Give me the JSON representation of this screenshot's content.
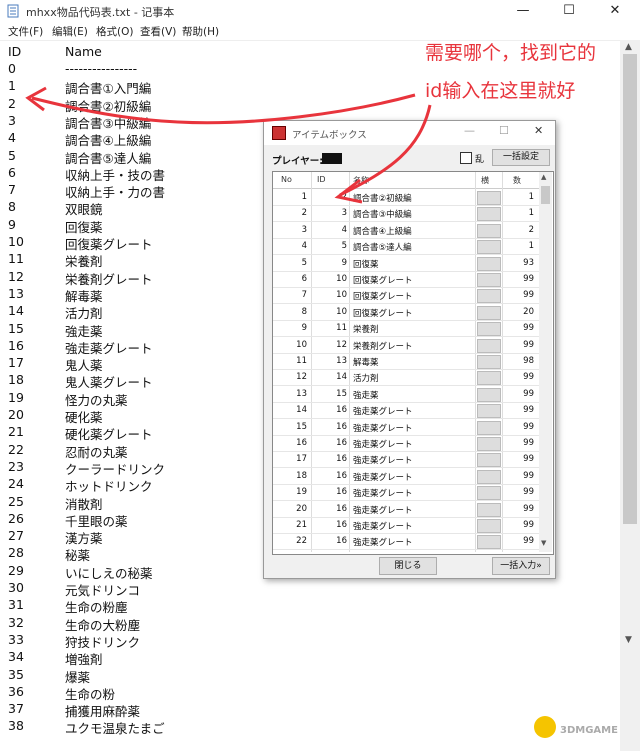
{
  "notepad": {
    "title": "mhxx物品代码表.txt - 记事本",
    "window_buttons": [
      "—",
      "☐",
      "✕"
    ],
    "menu": [
      "文件(F)",
      "编辑(E)",
      "格式(O)",
      "查看(V)",
      "帮助(H)"
    ],
    "header": {
      "id": "ID",
      "name": "Name"
    },
    "rows": [
      {
        "id": "0",
        "name": "----------------"
      },
      {
        "id": "1",
        "name": "調合書①入門編"
      },
      {
        "id": "2",
        "name": "調合書②初級編"
      },
      {
        "id": "3",
        "name": "調合書③中級編"
      },
      {
        "id": "4",
        "name": "調合書④上級編"
      },
      {
        "id": "5",
        "name": "調合書⑤達人編"
      },
      {
        "id": "6",
        "name": "収納上手・技の書"
      },
      {
        "id": "7",
        "name": "収納上手・力の書"
      },
      {
        "id": "8",
        "name": "双眼鏡"
      },
      {
        "id": "9",
        "name": "回復薬"
      },
      {
        "id": "10",
        "name": "回復薬グレート"
      },
      {
        "id": "11",
        "name": "栄養剤"
      },
      {
        "id": "12",
        "name": "栄養剤グレート"
      },
      {
        "id": "13",
        "name": "解毒薬"
      },
      {
        "id": "14",
        "name": "活力剤"
      },
      {
        "id": "15",
        "name": "強走薬"
      },
      {
        "id": "16",
        "name": "強走薬グレート"
      },
      {
        "id": "17",
        "name": "鬼人薬"
      },
      {
        "id": "18",
        "name": "鬼人薬グレート"
      },
      {
        "id": "19",
        "name": "怪力の丸薬"
      },
      {
        "id": "20",
        "name": "硬化薬"
      },
      {
        "id": "21",
        "name": "硬化薬グレート"
      },
      {
        "id": "22",
        "name": "忍耐の丸薬"
      },
      {
        "id": "23",
        "name": "クーラードリンク"
      },
      {
        "id": "24",
        "name": "ホットドリンク"
      },
      {
        "id": "25",
        "name": "消散剤"
      },
      {
        "id": "26",
        "name": "千里眼の薬"
      },
      {
        "id": "27",
        "name": "漢方薬"
      },
      {
        "id": "28",
        "name": "秘薬"
      },
      {
        "id": "29",
        "name": "いにしえの秘薬"
      },
      {
        "id": "30",
        "name": "元気ドリンコ"
      },
      {
        "id": "31",
        "name": "生命の粉塵"
      },
      {
        "id": "32",
        "name": "生命の大粉塵"
      },
      {
        "id": "33",
        "name": "狩技ドリンク"
      },
      {
        "id": "34",
        "name": "増強剤"
      },
      {
        "id": "35",
        "name": "爆薬"
      },
      {
        "id": "36",
        "name": "生命の粉"
      },
      {
        "id": "37",
        "name": "捕獲用麻酔薬"
      },
      {
        "id": "38",
        "name": "ユクモ温泉たまご"
      }
    ]
  },
  "dialog": {
    "title": "アイテムボックス",
    "window_buttons": [
      "—",
      "☐",
      "✕"
    ],
    "player_label": "プレイヤー:",
    "random_label": "乱",
    "bulk_set_button": "一括設定",
    "columns": {
      "no": "No",
      "id": "ID",
      "name": "名称",
      "flag": "横",
      "count": "数"
    },
    "rows": [
      {
        "no": "1",
        "id": "2",
        "name": "調合書②初級編",
        "count": "1"
      },
      {
        "no": "2",
        "id": "3",
        "name": "調合書③中級編",
        "count": "1"
      },
      {
        "no": "3",
        "id": "4",
        "name": "調合書④上級編",
        "count": "2"
      },
      {
        "no": "4",
        "id": "5",
        "name": "調合書⑤達人編",
        "count": "1"
      },
      {
        "no": "5",
        "id": "9",
        "name": "回復薬",
        "count": "93"
      },
      {
        "no": "6",
        "id": "10",
        "name": "回復薬グレート",
        "count": "99"
      },
      {
        "no": "7",
        "id": "10",
        "name": "回復薬グレート",
        "count": "99"
      },
      {
        "no": "8",
        "id": "10",
        "name": "回復薬グレート",
        "count": "20"
      },
      {
        "no": "9",
        "id": "11",
        "name": "栄養剤",
        "count": "99"
      },
      {
        "no": "10",
        "id": "12",
        "name": "栄養剤グレート",
        "count": "99"
      },
      {
        "no": "11",
        "id": "13",
        "name": "解毒薬",
        "count": "98"
      },
      {
        "no": "12",
        "id": "14",
        "name": "活力剤",
        "count": "99"
      },
      {
        "no": "13",
        "id": "15",
        "name": "強走薬",
        "count": "99"
      },
      {
        "no": "14",
        "id": "16",
        "name": "強走薬グレート",
        "count": "99"
      },
      {
        "no": "15",
        "id": "16",
        "name": "強走薬グレート",
        "count": "99"
      },
      {
        "no": "16",
        "id": "16",
        "name": "強走薬グレート",
        "count": "99"
      },
      {
        "no": "17",
        "id": "16",
        "name": "強走薬グレート",
        "count": "99"
      },
      {
        "no": "18",
        "id": "16",
        "name": "強走薬グレート",
        "count": "99"
      },
      {
        "no": "19",
        "id": "16",
        "name": "強走薬グレート",
        "count": "99"
      },
      {
        "no": "20",
        "id": "16",
        "name": "強走薬グレート",
        "count": "99"
      },
      {
        "no": "21",
        "id": "16",
        "name": "強走薬グレート",
        "count": "99"
      },
      {
        "no": "22",
        "id": "16",
        "name": "強走薬グレート",
        "count": "99"
      }
    ],
    "close_button": "閉じる",
    "bulk_input_button": "一括入力»"
  },
  "annotation": {
    "line1": "需要哪个，找到它的",
    "line2": "id输入在这里就好",
    "color": "#e8343c"
  },
  "watermark": "3DMGAME"
}
